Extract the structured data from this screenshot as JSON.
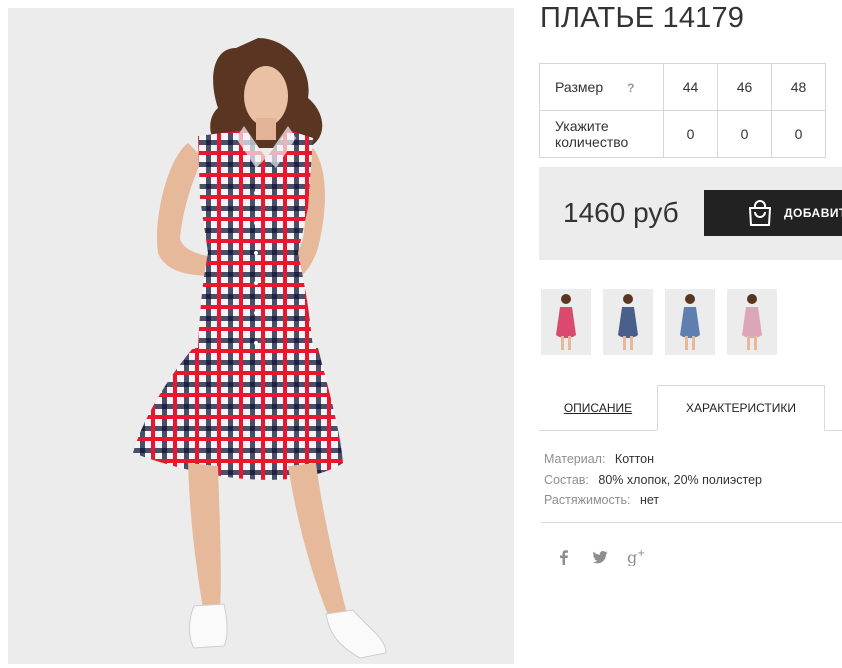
{
  "product": {
    "title": "ПЛАТЬЕ 14179",
    "main_image": "model-in-red-checked-dress"
  },
  "size_table": {
    "size_label": "Размер",
    "help_icon": "?",
    "sizes": [
      "44",
      "46",
      "48"
    ],
    "qty_label_line1": "Укажите",
    "qty_label_line2": "количество",
    "quantities": [
      "0",
      "0",
      "0"
    ]
  },
  "purchase": {
    "price": "1460 руб",
    "add_button_label": "ДОБАВИТЬ",
    "button_icon": "shopping-bag-icon"
  },
  "thumbnails": [
    {
      "color_name": "red-check",
      "dress_color": "#d94a6e"
    },
    {
      "color_name": "navy-check",
      "dress_color": "#4a5f8c"
    },
    {
      "color_name": "blue-check",
      "dress_color": "#5f7fb0"
    },
    {
      "color_name": "pink-check",
      "dress_color": "#dba7b8"
    }
  ],
  "tabs": {
    "description": "ОПИСАНИЕ",
    "characteristics": "ХАРАКТЕРИСТИКИ",
    "active": "characteristics"
  },
  "specs": [
    {
      "key": "Материал:",
      "value": "Коттон"
    },
    {
      "key": "Состав:",
      "value": "80% хлопок, 20% полиэстер"
    },
    {
      "key": "Растяжимость:",
      "value": "нет"
    }
  ],
  "social": [
    "facebook-icon",
    "twitter-icon",
    "google-plus-icon"
  ],
  "colors": {
    "accent_dark": "#222222",
    "panel_gray": "#ececec",
    "dress_red": "#e8172f",
    "dress_navy": "#2c3150"
  }
}
